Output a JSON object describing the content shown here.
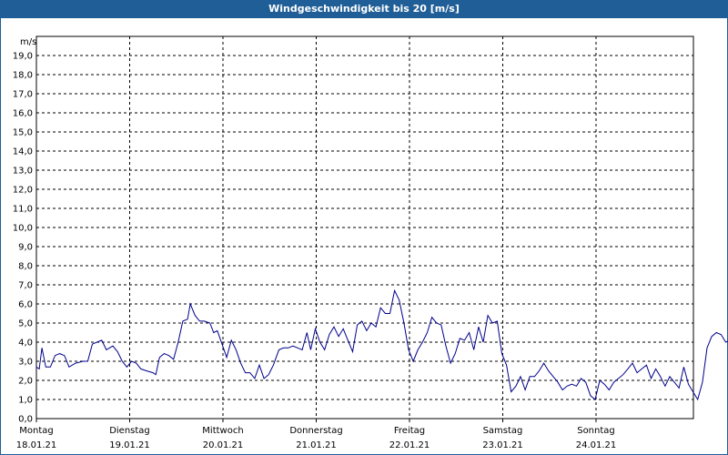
{
  "chart_data": {
    "type": "line",
    "title": "Windgeschwindigkeit bis 20 [m/s]",
    "ylabel": "m/s",
    "xlabel": "",
    "ylim": [
      0,
      20
    ],
    "grid": true,
    "yticks": [
      "0,0",
      "1,0",
      "2,0",
      "3,0",
      "4,0",
      "5,0",
      "6,0",
      "7,0",
      "8,0",
      "9,0",
      "10,0",
      "11,0",
      "12,0",
      "13,0",
      "14,0",
      "15,0",
      "16,0",
      "17,0",
      "18,0",
      "19,0"
    ],
    "days": [
      {
        "name": "Montag",
        "date": "18.01.21"
      },
      {
        "name": "Dienstag",
        "date": "19.01.21"
      },
      {
        "name": "Mittwoch",
        "date": "20.01.21"
      },
      {
        "name": "Donnerstag",
        "date": "21.01.21"
      },
      {
        "name": "Freitag",
        "date": "22.01.21"
      },
      {
        "name": "Samstag",
        "date": "23.01.21"
      },
      {
        "name": "Sonntag",
        "date": "24.01.21"
      }
    ],
    "series": [
      {
        "color": "#00008b",
        "x_unit": "days since 18.01.21 00:00",
        "points": [
          [
            0.0,
            2.7
          ],
          [
            0.03,
            2.6
          ],
          [
            0.06,
            3.7
          ],
          [
            0.1,
            2.7
          ],
          [
            0.15,
            2.7
          ],
          [
            0.2,
            3.3
          ],
          [
            0.25,
            3.4
          ],
          [
            0.3,
            3.3
          ],
          [
            0.35,
            2.7
          ],
          [
            0.42,
            2.9
          ],
          [
            0.5,
            3.0
          ],
          [
            0.55,
            3.0
          ],
          [
            0.6,
            3.9
          ],
          [
            0.65,
            4.0
          ],
          [
            0.7,
            4.1
          ],
          [
            0.75,
            3.6
          ],
          [
            0.82,
            3.8
          ],
          [
            0.87,
            3.5
          ],
          [
            0.92,
            3.0
          ],
          [
            0.97,
            2.7
          ],
          [
            1.02,
            3.0
          ],
          [
            1.07,
            2.9
          ],
          [
            1.12,
            2.6
          ],
          [
            1.18,
            2.5
          ],
          [
            1.25,
            2.4
          ],
          [
            1.28,
            2.3
          ],
          [
            1.32,
            3.2
          ],
          [
            1.37,
            3.4
          ],
          [
            1.42,
            3.3
          ],
          [
            1.47,
            3.1
          ],
          [
            1.52,
            4.0
          ],
          [
            1.57,
            5.1
          ],
          [
            1.62,
            5.2
          ],
          [
            1.65,
            6.0
          ],
          [
            1.7,
            5.4
          ],
          [
            1.75,
            5.1
          ],
          [
            1.8,
            5.1
          ],
          [
            1.86,
            5.0
          ],
          [
            1.9,
            4.5
          ],
          [
            1.94,
            4.6
          ],
          [
            1.99,
            3.9
          ],
          [
            2.04,
            3.2
          ],
          [
            2.09,
            4.1
          ],
          [
            2.14,
            3.6
          ],
          [
            2.19,
            2.9
          ],
          [
            2.24,
            2.4
          ],
          [
            2.29,
            2.4
          ],
          [
            2.34,
            2.1
          ],
          [
            2.39,
            2.8
          ],
          [
            2.44,
            2.1
          ],
          [
            2.49,
            2.3
          ],
          [
            2.54,
            2.8
          ],
          [
            2.6,
            3.6
          ],
          [
            2.65,
            3.7
          ],
          [
            2.7,
            3.7
          ],
          [
            2.75,
            3.8
          ],
          [
            2.8,
            3.7
          ],
          [
            2.85,
            3.6
          ],
          [
            2.9,
            4.5
          ],
          [
            2.94,
            3.6
          ],
          [
            2.99,
            4.7
          ],
          [
            3.04,
            4.0
          ],
          [
            3.09,
            3.6
          ],
          [
            3.14,
            4.4
          ],
          [
            3.19,
            4.8
          ],
          [
            3.24,
            4.3
          ],
          [
            3.29,
            4.7
          ],
          [
            3.34,
            4.1
          ],
          [
            3.39,
            3.5
          ],
          [
            3.44,
            4.9
          ],
          [
            3.49,
            5.1
          ],
          [
            3.54,
            4.6
          ],
          [
            3.59,
            5.0
          ],
          [
            3.64,
            4.8
          ],
          [
            3.69,
            5.8
          ],
          [
            3.74,
            5.5
          ],
          [
            3.79,
            5.5
          ],
          [
            3.84,
            6.7
          ],
          [
            3.89,
            6.2
          ],
          [
            3.94,
            5.0
          ],
          [
            3.99,
            3.6
          ],
          [
            4.04,
            3.0
          ],
          [
            4.09,
            3.6
          ],
          [
            4.14,
            4.0
          ],
          [
            4.19,
            4.5
          ],
          [
            4.24,
            5.3
          ],
          [
            4.29,
            5.0
          ],
          [
            4.34,
            4.9
          ],
          [
            4.39,
            3.8
          ],
          [
            4.44,
            2.9
          ],
          [
            4.49,
            3.4
          ],
          [
            4.54,
            4.2
          ],
          [
            4.59,
            4.1
          ],
          [
            4.64,
            4.5
          ],
          [
            4.69,
            3.6
          ],
          [
            4.74,
            4.8
          ],
          [
            4.79,
            4.0
          ],
          [
            4.84,
            5.4
          ],
          [
            4.89,
            5.0
          ],
          [
            4.94,
            5.1
          ],
          [
            4.99,
            3.4
          ],
          [
            5.04,
            2.8
          ],
          [
            5.09,
            1.4
          ],
          [
            5.14,
            1.7
          ],
          [
            5.19,
            2.2
          ],
          [
            5.24,
            1.5
          ],
          [
            5.29,
            2.2
          ],
          [
            5.34,
            2.2
          ],
          [
            5.39,
            2.5
          ],
          [
            5.44,
            2.9
          ],
          [
            5.49,
            2.5
          ],
          [
            5.54,
            2.2
          ],
          [
            5.59,
            1.9
          ],
          [
            5.64,
            1.5
          ],
          [
            5.69,
            1.7
          ],
          [
            5.74,
            1.8
          ],
          [
            5.79,
            1.7
          ],
          [
            5.84,
            2.1
          ],
          [
            5.89,
            1.9
          ],
          [
            5.94,
            1.2
          ],
          [
            5.99,
            1.0
          ],
          [
            6.04,
            2.0
          ],
          [
            6.09,
            1.8
          ],
          [
            6.14,
            1.5
          ],
          [
            6.19,
            1.9
          ],
          [
            6.24,
            2.1
          ],
          [
            6.29,
            2.3
          ],
          [
            6.34,
            2.6
          ],
          [
            6.39,
            2.9
          ],
          [
            6.44,
            2.4
          ],
          [
            6.49,
            2.6
          ],
          [
            6.54,
            2.8
          ],
          [
            6.59,
            2.1
          ],
          [
            6.64,
            2.6
          ],
          [
            6.69,
            2.2
          ],
          [
            6.74,
            1.7
          ],
          [
            6.79,
            2.2
          ],
          [
            6.84,
            1.9
          ],
          [
            6.89,
            1.6
          ],
          [
            6.94,
            2.7
          ],
          [
            6.99,
            1.8
          ],
          [
            7.04,
            1.4
          ],
          [
            7.09,
            1.0
          ],
          [
            7.14,
            1.9
          ],
          [
            7.19,
            3.7
          ],
          [
            7.24,
            4.3
          ],
          [
            7.29,
            4.5
          ],
          [
            7.34,
            4.4
          ],
          [
            7.39,
            4.0
          ],
          [
            7.44,
            4.1
          ],
          [
            7.49,
            3.2
          ],
          [
            7.54,
            3.2
          ],
          [
            7.59,
            3.6
          ],
          [
            7.64,
            4.1
          ],
          [
            7.69,
            3.7
          ],
          [
            7.74,
            3.3
          ],
          [
            7.79,
            3.4
          ],
          [
            7.84,
            2.8
          ],
          [
            7.89,
            2.7
          ],
          [
            7.94,
            2.4
          ],
          [
            7.99,
            2.1
          ],
          [
            8.04,
            2.0
          ],
          [
            8.09,
            2.6
          ],
          [
            8.14,
            3.0
          ],
          [
            8.19,
            2.3
          ],
          [
            8.24,
            1.9
          ]
        ]
      }
    ]
  }
}
